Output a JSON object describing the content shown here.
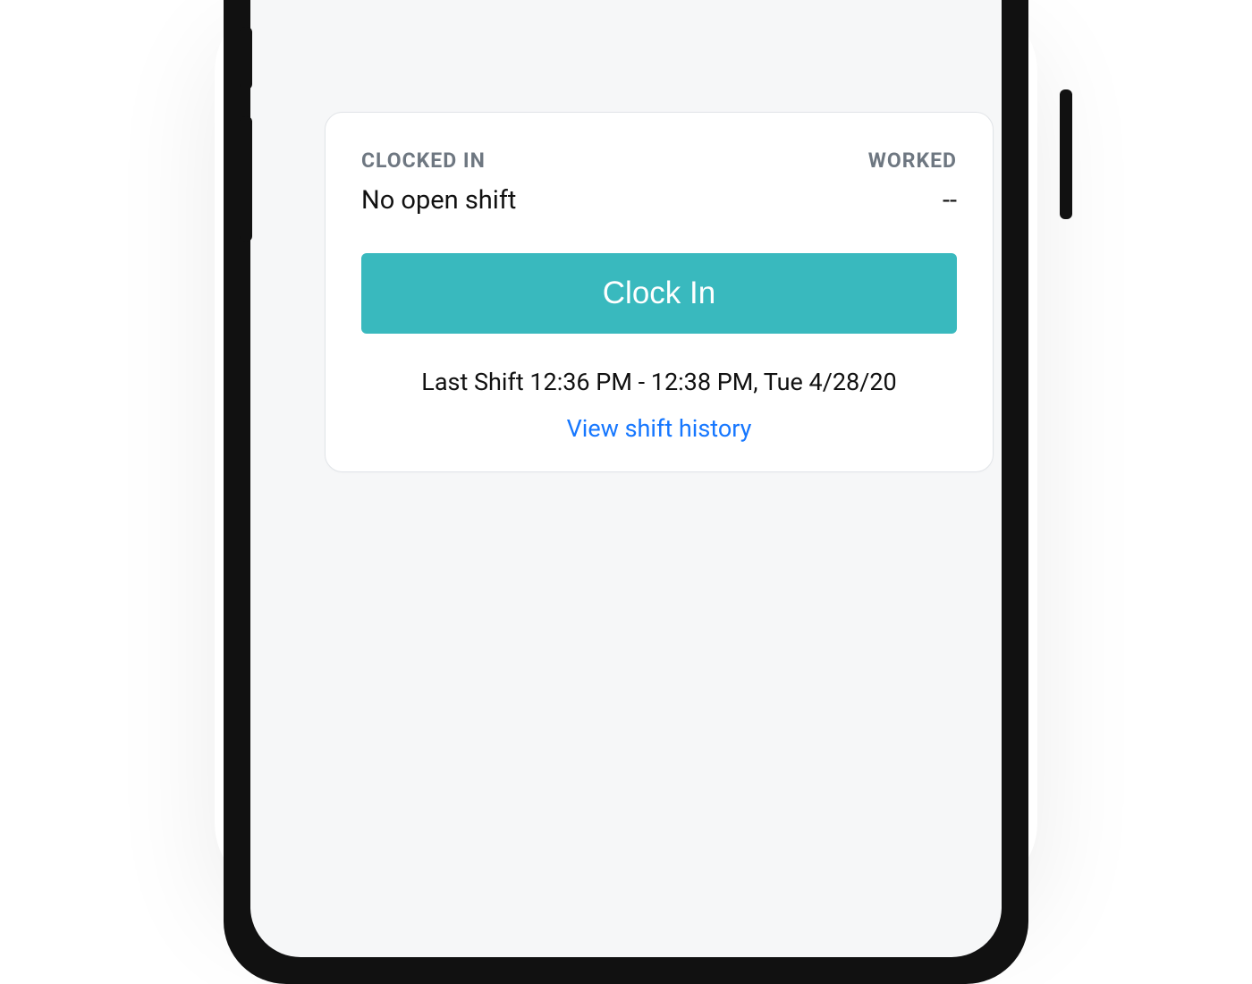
{
  "card": {
    "clockedIn": {
      "label": "CLOCKED IN",
      "value": "No open shift"
    },
    "worked": {
      "label": "WORKED",
      "value": "--"
    },
    "primaryButton": "Clock In",
    "lastShift": "Last Shift 12:36 PM - 12:38 PM, Tue 4/28/20",
    "historyLink": "View shift history"
  },
  "colors": {
    "accent": "#39b9be",
    "link": "#1677ff",
    "muted": "#6e7781"
  }
}
